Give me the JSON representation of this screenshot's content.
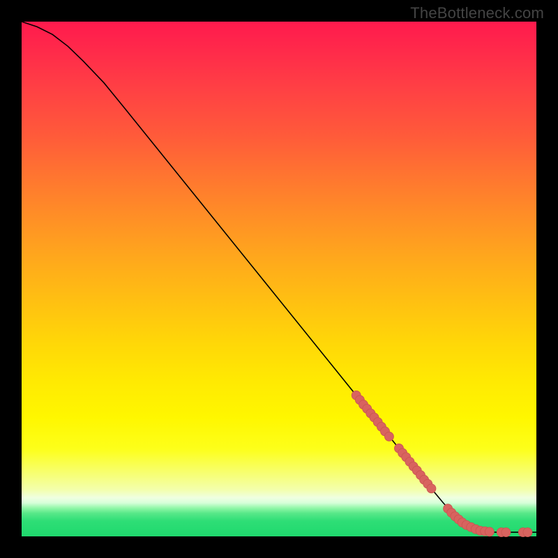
{
  "watermark": "TheBottleneck.com",
  "chart_data": {
    "type": "line",
    "title": "",
    "xlabel": "",
    "ylabel": "",
    "xlim": [
      0,
      100
    ],
    "ylim": [
      0,
      100
    ],
    "grid": false,
    "legend": false,
    "series": [
      {
        "name": "curve",
        "x": [
          0,
          3,
          6,
          9,
          12,
          16,
          20,
          25,
          30,
          35,
          40,
          45,
          50,
          55,
          60,
          65,
          70,
          74,
          77,
          80,
          82,
          84,
          86,
          88,
          90,
          92,
          94,
          96,
          98,
          100
        ],
        "y": [
          100,
          99,
          97.5,
          95.2,
          92.3,
          88.1,
          83.2,
          77.0,
          70.8,
          64.6,
          58.4,
          52.2,
          46.0,
          39.8,
          33.6,
          27.4,
          21.2,
          16.2,
          12.5,
          8.8,
          6.4,
          4.3,
          2.7,
          1.6,
          1.0,
          0.8,
          0.8,
          0.8,
          0.8,
          0.8
        ]
      }
    ],
    "markers": [
      {
        "x": 65.0,
        "y": 27.4
      },
      {
        "x": 65.7,
        "y": 26.5
      },
      {
        "x": 66.4,
        "y": 25.6
      },
      {
        "x": 67.1,
        "y": 24.8
      },
      {
        "x": 67.8,
        "y": 23.9
      },
      {
        "x": 68.5,
        "y": 23.1
      },
      {
        "x": 69.2,
        "y": 22.2
      },
      {
        "x": 69.9,
        "y": 21.3
      },
      {
        "x": 70.6,
        "y": 20.4
      },
      {
        "x": 71.4,
        "y": 19.4
      },
      {
        "x": 73.3,
        "y": 17.1
      },
      {
        "x": 74.0,
        "y": 16.2
      },
      {
        "x": 74.7,
        "y": 15.4
      },
      {
        "x": 75.4,
        "y": 14.5
      },
      {
        "x": 76.1,
        "y": 13.6
      },
      {
        "x": 76.8,
        "y": 12.8
      },
      {
        "x": 77.5,
        "y": 11.9
      },
      {
        "x": 78.2,
        "y": 11.0
      },
      {
        "x": 78.9,
        "y": 10.2
      },
      {
        "x": 79.6,
        "y": 9.3
      },
      {
        "x": 82.8,
        "y": 5.4
      },
      {
        "x": 83.5,
        "y": 4.6
      },
      {
        "x": 84.2,
        "y": 3.9
      },
      {
        "x": 84.9,
        "y": 3.3
      },
      {
        "x": 85.6,
        "y": 2.7
      },
      {
        "x": 86.4,
        "y": 2.2
      },
      {
        "x": 87.3,
        "y": 1.8
      },
      {
        "x": 88.2,
        "y": 1.4
      },
      {
        "x": 89.1,
        "y": 1.1
      },
      {
        "x": 90.0,
        "y": 1.0
      },
      {
        "x": 90.9,
        "y": 0.9
      },
      {
        "x": 93.2,
        "y": 0.8
      },
      {
        "x": 94.1,
        "y": 0.8
      },
      {
        "x": 97.4,
        "y": 0.8
      },
      {
        "x": 98.3,
        "y": 0.8
      }
    ]
  }
}
